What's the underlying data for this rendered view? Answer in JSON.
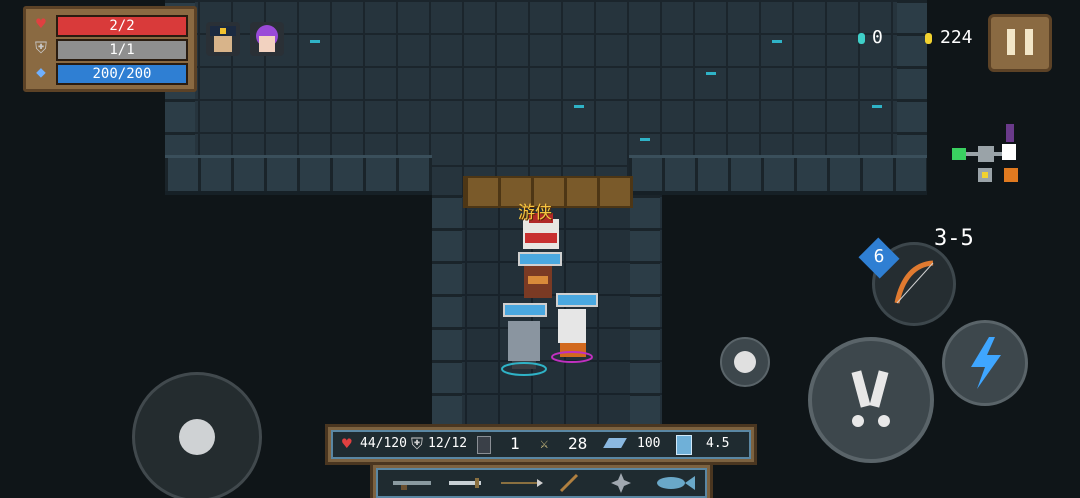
{
  "hud": {
    "hp_text": "2/2",
    "shield_text": "1/1",
    "energy_text": "200/200",
    "hp_fill": 1.0,
    "shield_fill": 1.0,
    "energy_fill": 1.0
  },
  "buffs": [
    "police-hat-buff-icon",
    "purple-hair-girl-buff-icon"
  ],
  "currency": {
    "gems": "0",
    "coins": "224"
  },
  "level": "3-5",
  "weapon": {
    "energy_cost": "6",
    "name_icon": "bow-icon"
  },
  "character": {
    "name_tag": "游侠"
  },
  "stats_panel": {
    "hp": "44/120",
    "armor": "12/12",
    "crit": "1",
    "attack": "28",
    "speed": "100",
    "extra": "4.5"
  },
  "weapon_bar": [
    "rifle-icon",
    "sword-icon",
    "spear-icon",
    "staff-icon",
    "shuriken-icon",
    "fish-icon"
  ],
  "colors": {
    "hp": "#d93a3a",
    "shield": "#8f8f8f",
    "energy": "#2f7fd3",
    "accent": "#2fb3c7",
    "panel": "#8a6a42"
  }
}
